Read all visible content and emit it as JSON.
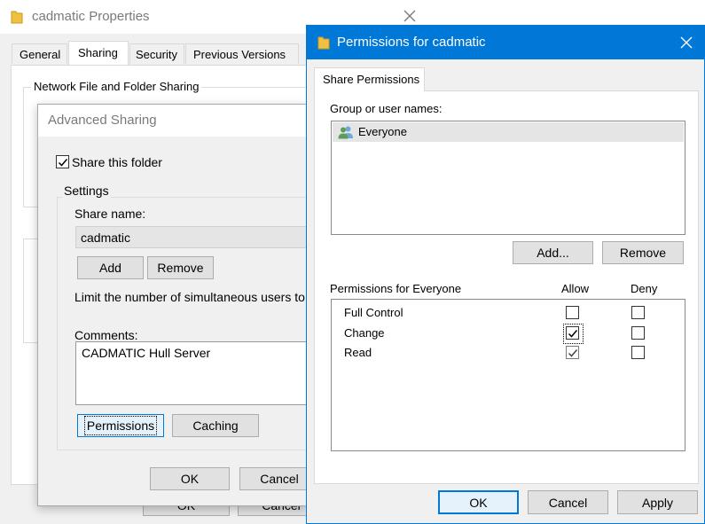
{
  "properties": {
    "title": "cadmatic Properties",
    "tabs": [
      "General",
      "Sharing",
      "Security",
      "Previous Versions"
    ],
    "section_label": "Network File and Folder Sharing",
    "ok_label": "OK",
    "cancel_label": "Cancel"
  },
  "advanced_sharing": {
    "title": "Advanced Sharing",
    "share_checkbox_label": "Share this folder",
    "share_checked": true,
    "settings_label": "Settings",
    "share_name_label": "Share name:",
    "share_name_value": "cadmatic",
    "add_label": "Add",
    "remove_label": "Remove",
    "limit_label": "Limit the number of simultaneous users to:",
    "comments_label": "Comments:",
    "comments_value": "CADMATIC Hull Server",
    "permissions_label": "Permissions",
    "caching_label": "Caching",
    "ok_label": "OK",
    "cancel_label": "Cancel"
  },
  "permissions": {
    "title": "Permissions for cadmatic",
    "tab_label": "Share Permissions",
    "group_label": "Group or user names:",
    "users": [
      "Everyone"
    ],
    "add_label": "Add...",
    "remove_label": "Remove",
    "perm_for_label": "Permissions for Everyone",
    "allow_header": "Allow",
    "deny_header": "Deny",
    "rows": [
      {
        "name": "Full Control",
        "allow": false,
        "deny": false
      },
      {
        "name": "Change",
        "allow": true,
        "deny": false
      },
      {
        "name": "Read",
        "allow": true,
        "deny": false
      }
    ],
    "ok_label": "OK",
    "cancel_label": "Cancel",
    "apply_label": "Apply"
  },
  "colors": {
    "accent": "#0078d7",
    "title_bar_active": "#0078d7",
    "folder_icon": "#f0c040"
  }
}
